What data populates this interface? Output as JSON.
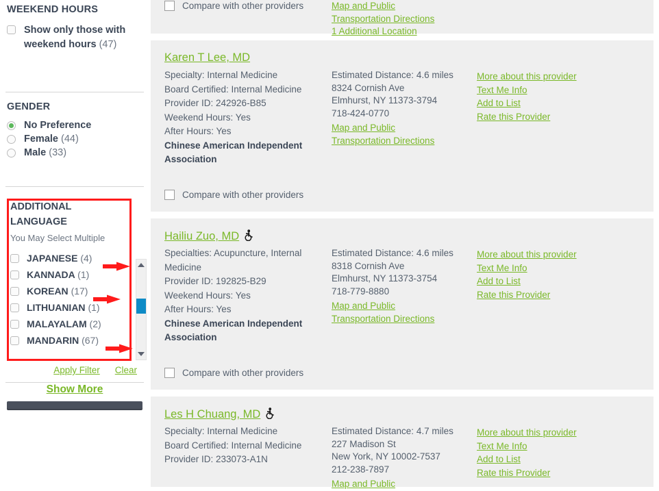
{
  "sidebar": {
    "weekend": {
      "title": "WEEKEND HOURS",
      "option_label": "Show only those with weekend hours",
      "option_count": "(47)"
    },
    "gender": {
      "title": "GENDER",
      "options": [
        {
          "label": "No Preference",
          "count": "",
          "selected": true
        },
        {
          "label": "Female",
          "count": "(44)",
          "selected": false
        },
        {
          "label": "Male",
          "count": "(33)",
          "selected": false
        }
      ]
    },
    "language": {
      "title_line1": "ADDITIONAL",
      "title_line2": "LANGUAGE",
      "subtitle": "You May Select Multiple",
      "items": [
        {
          "label": "JAPANESE",
          "count": "(4)",
          "arrow": true
        },
        {
          "label": "KANNADA",
          "count": "(1)",
          "arrow": false
        },
        {
          "label": "KOREAN",
          "count": "(17)",
          "arrow": true
        },
        {
          "label": "LITHUANIAN",
          "count": "(1)",
          "arrow": false
        },
        {
          "label": "MALAYALAM",
          "count": "(2)",
          "arrow": false
        },
        {
          "label": "MANDARIN",
          "count": "(67)",
          "arrow": true
        }
      ],
      "apply_label": "Apply Filter",
      "clear_label": "Clear"
    },
    "show_more_label": "Show More"
  },
  "results": {
    "compare_label": "Compare with other providers",
    "top_partial": {
      "map_line1": "Map and Public",
      "map_line2": "Transportation Directions",
      "additional_location": "1 Additional Location",
      "compare_label": "Compare with other providers"
    },
    "cards": [
      {
        "name": "Karen T Lee, MD",
        "accessible": false,
        "details": [
          "Specialty: Internal Medicine",
          "Board Certified: Internal Medicine",
          "Provider ID: 242926-B85",
          "Weekend Hours: Yes",
          "After Hours: Yes"
        ],
        "association": "Chinese American Independent Association",
        "distance_label": "Estimated Distance:",
        "distance_value": "4.6 miles",
        "address_line1": "8324 Cornish Ave",
        "address_line2": "Elmhurst, NY 11373-3794",
        "phone": "718-424-0770",
        "map_line1": "Map and Public",
        "map_line2": "Transportation Directions",
        "actions": [
          "More about this provider",
          "Text Me Info",
          "Add to List",
          "Rate this Provider"
        ]
      },
      {
        "name": "Hailiu Zuo, MD",
        "accessible": true,
        "details": [
          "Specialties: Acupuncture, Internal",
          "Medicine",
          "Provider ID: 192825-B29",
          "Weekend Hours: Yes",
          "After Hours: Yes"
        ],
        "association": "Chinese American Independent Association",
        "distance_label": "Estimated Distance:",
        "distance_value": "4.6 miles",
        "address_line1": "8318 Cornish Ave",
        "address_line2": "Elmhurst, NY 11373-3754",
        "phone": "718-779-8880",
        "map_line1": "Map and Public",
        "map_line2": "Transportation Directions",
        "actions": [
          "More about this provider",
          "Text Me Info",
          "Add to List",
          "Rate this Provider"
        ]
      },
      {
        "name": "Les H Chuang, MD",
        "accessible": true,
        "details": [
          "Specialty: Internal Medicine",
          "Board Certified: Internal Medicine",
          "Provider ID: 233073-A1N"
        ],
        "association": "",
        "distance_label": "Estimated Distance:",
        "distance_value": "4.7 miles",
        "address_line1": "227 Madison St",
        "address_line2": "New York, NY 10002-7537",
        "phone": "212-238-7897",
        "map_line1": "Map and Public",
        "map_line2": "",
        "actions": [
          "More about this provider",
          "Text Me Info",
          "Add to List",
          "Rate this Provider"
        ]
      }
    ]
  },
  "colors": {
    "link_green": "#7ab828",
    "text_dark": "#3b4656",
    "text_body": "#55606e",
    "card_bg": "#efefef",
    "annotation_red": "#ff1b1b",
    "scroll_thumb": "#0e8bc6",
    "radio_green": "#5cb85c"
  }
}
